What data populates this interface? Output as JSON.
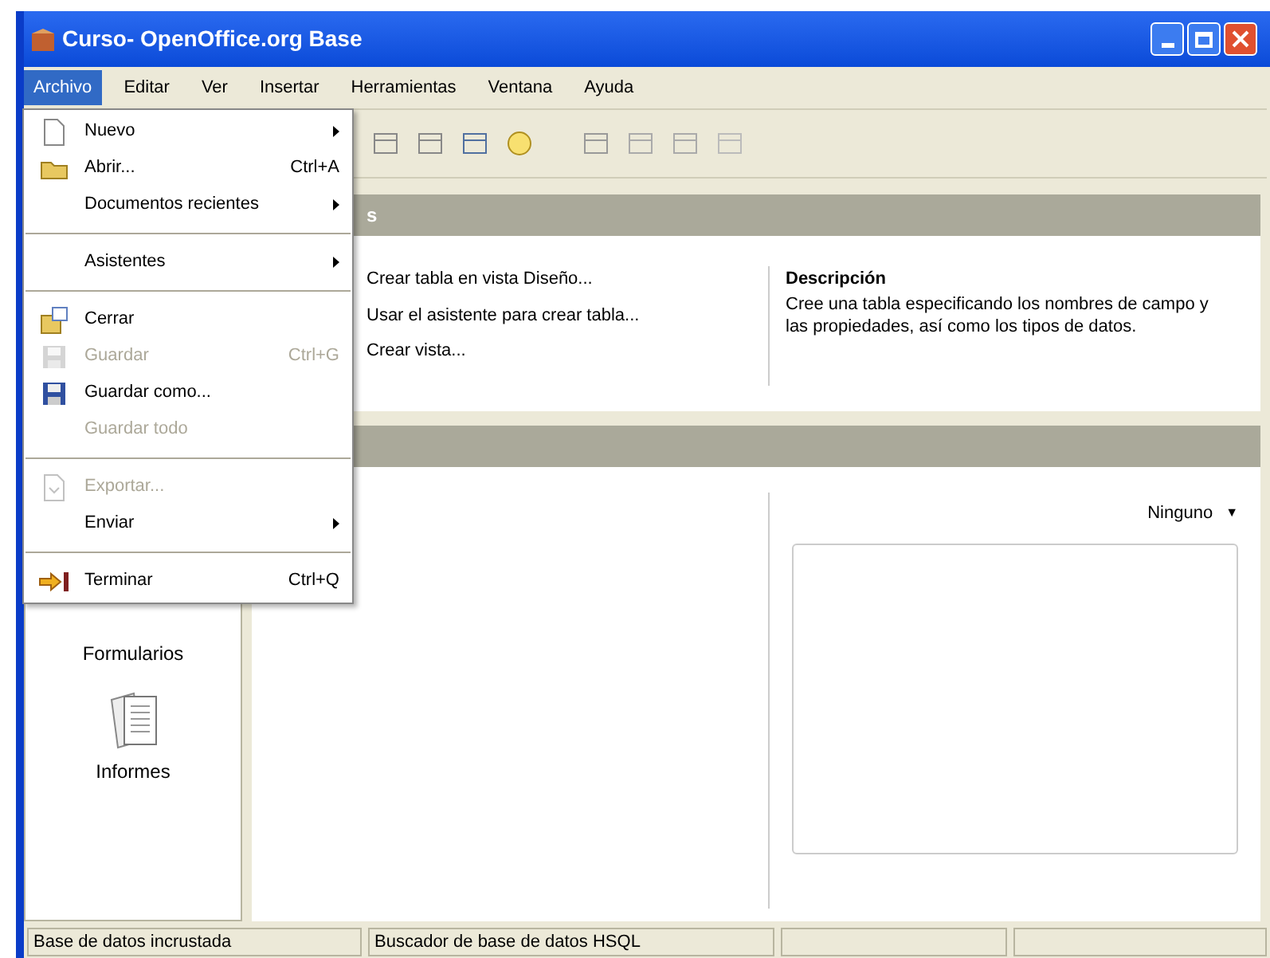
{
  "window": {
    "title": "Curso- OpenOffice.org Base"
  },
  "menubar": [
    {
      "label": "Archivo",
      "selected": true
    },
    {
      "label": "Editar",
      "selected": false
    },
    {
      "label": "Ver",
      "selected": false
    },
    {
      "label": "Insertar",
      "selected": false
    },
    {
      "label": "Herramientas",
      "selected": false
    },
    {
      "label": "Ventana",
      "selected": false
    },
    {
      "label": "Ayuda",
      "selected": false
    }
  ],
  "file_menu": [
    {
      "kind": "item",
      "label": "Nuevo",
      "submenu": true,
      "disabled": false
    },
    {
      "kind": "item",
      "label": "Abrir...",
      "shortcut": "Ctrl+A",
      "submenu": false,
      "disabled": false
    },
    {
      "kind": "item",
      "label": "Documentos recientes",
      "submenu": true,
      "disabled": false
    },
    {
      "kind": "separator"
    },
    {
      "kind": "item",
      "label": "Asistentes",
      "submenu": true,
      "disabled": false
    },
    {
      "kind": "separator"
    },
    {
      "kind": "item",
      "label": "Cerrar",
      "submenu": false,
      "disabled": false
    },
    {
      "kind": "item",
      "label": "Guardar",
      "shortcut": "Ctrl+G",
      "submenu": false,
      "disabled": true
    },
    {
      "kind": "item",
      "label": "Guardar como...",
      "submenu": false,
      "disabled": false
    },
    {
      "kind": "item",
      "label": "Guardar todo",
      "submenu": false,
      "disabled": true
    },
    {
      "kind": "separator"
    },
    {
      "kind": "item",
      "label": "Exportar...",
      "submenu": false,
      "disabled": true
    },
    {
      "kind": "item",
      "label": "Enviar",
      "submenu": true,
      "disabled": false
    },
    {
      "kind": "separator"
    },
    {
      "kind": "item",
      "label": "Terminar",
      "shortcut": "Ctrl+Q",
      "submenu": false,
      "disabled": false
    }
  ],
  "sidebar": {
    "items": [
      {
        "label": "Formularios"
      },
      {
        "label": "Informes"
      }
    ]
  },
  "tasks_section": {
    "header": "s",
    "tasks": [
      "Crear tabla en vista Diseño...",
      "Usar el asistente para crear tabla...",
      "Crear vista..."
    ],
    "description_title": "Descripción",
    "description": "Cree una tabla especificando los nombres de campo y las propiedades, así como los tipos de datos."
  },
  "tables_section": {
    "preview_mode": "Ninguno",
    "preview_arrow": "▼"
  },
  "status_bar": [
    "Base de datos incrustada",
    "Buscador de base de datos HSQL"
  ]
}
